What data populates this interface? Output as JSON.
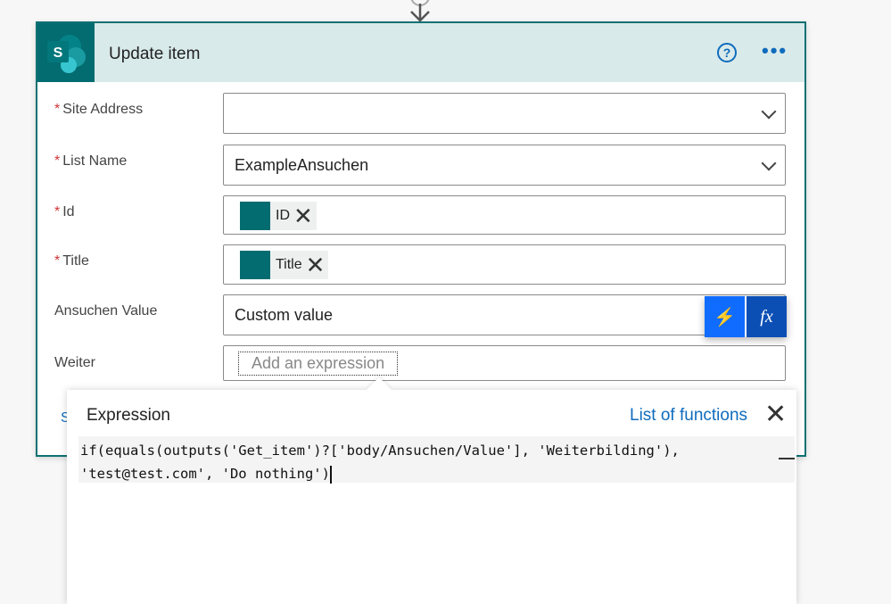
{
  "card": {
    "title": "Update item",
    "help_icon": "help-circle-icon",
    "more_icon": "more-ellipsis-icon",
    "brand_color": "#036c70"
  },
  "fields": [
    {
      "label": "Site Address",
      "required": true,
      "value": ""
    },
    {
      "label": "List Name",
      "required": true,
      "value": "ExampleAnsuchen"
    },
    {
      "label": "Id",
      "required": true,
      "token": "ID"
    },
    {
      "label": "Title",
      "required": true,
      "token": "Title"
    },
    {
      "label": "Ansuchen Value",
      "required": false,
      "value": "Custom value"
    },
    {
      "label": "Weiter",
      "required": false,
      "placeholder": "Add an expression"
    }
  ],
  "required_mark": "*",
  "dynamic": {
    "fx_label": "fx"
  },
  "advanced_fragment": "S",
  "expression": {
    "title": "Expression",
    "list_link": "List of functions",
    "line1": "if(equals(outputs('Get_item')?['body/Ansuchen/Value'], 'Weiterbilding'),",
    "line2": "'test@test.com', 'Do nothing')"
  }
}
